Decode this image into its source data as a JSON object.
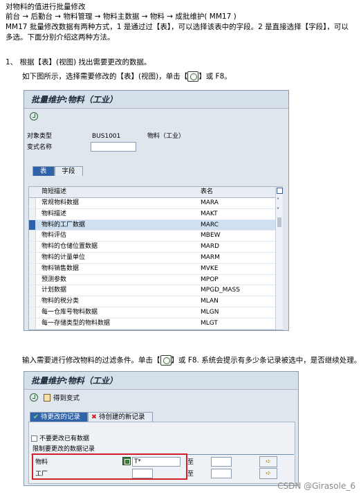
{
  "doc": {
    "line1": "对物料的值进行批量修改",
    "line2": "前台 → 后勤台 → 物料管理 → 物料主数据 → 物料 → 成批维护( MM17 )",
    "line3": "MM17 批量修改数据有两种方式，1 是通过过【表】，可以选择该表中的字段。2 是直接选择【字段】，可以多选。下面分别介绍这两种方法。",
    "step1": "1、 根据【表】(视图) 找出需要更改的数据。",
    "caption1_pre": "如下图所示，选择需要修改的【表】(视图)，单击【",
    "caption1_post": "】或 F8。",
    "caption2_pre": "输入需要进行修改物料的过滤条件。单击【",
    "caption2_post": "】或 F8. 系统会提示有多少条记录被选中，是否继续处理。"
  },
  "win1": {
    "title": "批量维护:物料（工业）",
    "obj_type_label": "对象类型",
    "obj_type_code": "BUS1001",
    "obj_type_name": "物料（工业）",
    "variant_label": "变式名称",
    "tabs": [
      "表",
      "字段"
    ],
    "col_desc": "简短描述",
    "col_table": "表名",
    "rows": [
      {
        "desc": "常规物料数据",
        "table": "MARA"
      },
      {
        "desc": "物料描述",
        "table": "MAKT"
      },
      {
        "desc": "物料的工厂数据",
        "table": "MARC"
      },
      {
        "desc": "物料评估",
        "table": "MBEW"
      },
      {
        "desc": "物料的仓储位置数据",
        "table": "MARD"
      },
      {
        "desc": "物料的计量单位",
        "table": "MARM"
      },
      {
        "desc": "物料销售数据",
        "table": "MVKE"
      },
      {
        "desc": "预测参数",
        "table": "MPOP"
      },
      {
        "desc": "计划数据",
        "table": "MPGD_MASS"
      },
      {
        "desc": "物料的税分类",
        "table": "MLAN"
      },
      {
        "desc": "每一仓库号物料数据",
        "table": "MLGN"
      },
      {
        "desc": "每一存储类型的物料数据",
        "table": "MLGT"
      }
    ]
  },
  "win2": {
    "title": "批量维护:物料（工业）",
    "get_variant": "得到变式",
    "tab_change": "待更改的记录",
    "tab_new": "待创建的新记录",
    "no_change_label": "不要更改已有数据",
    "restrict_label": "限制要更改的数据记录",
    "material_label": "物料",
    "material_value": "T*",
    "plant_label": "工厂",
    "to_label": "至"
  },
  "watermark": "CSDN @Girasole_6"
}
